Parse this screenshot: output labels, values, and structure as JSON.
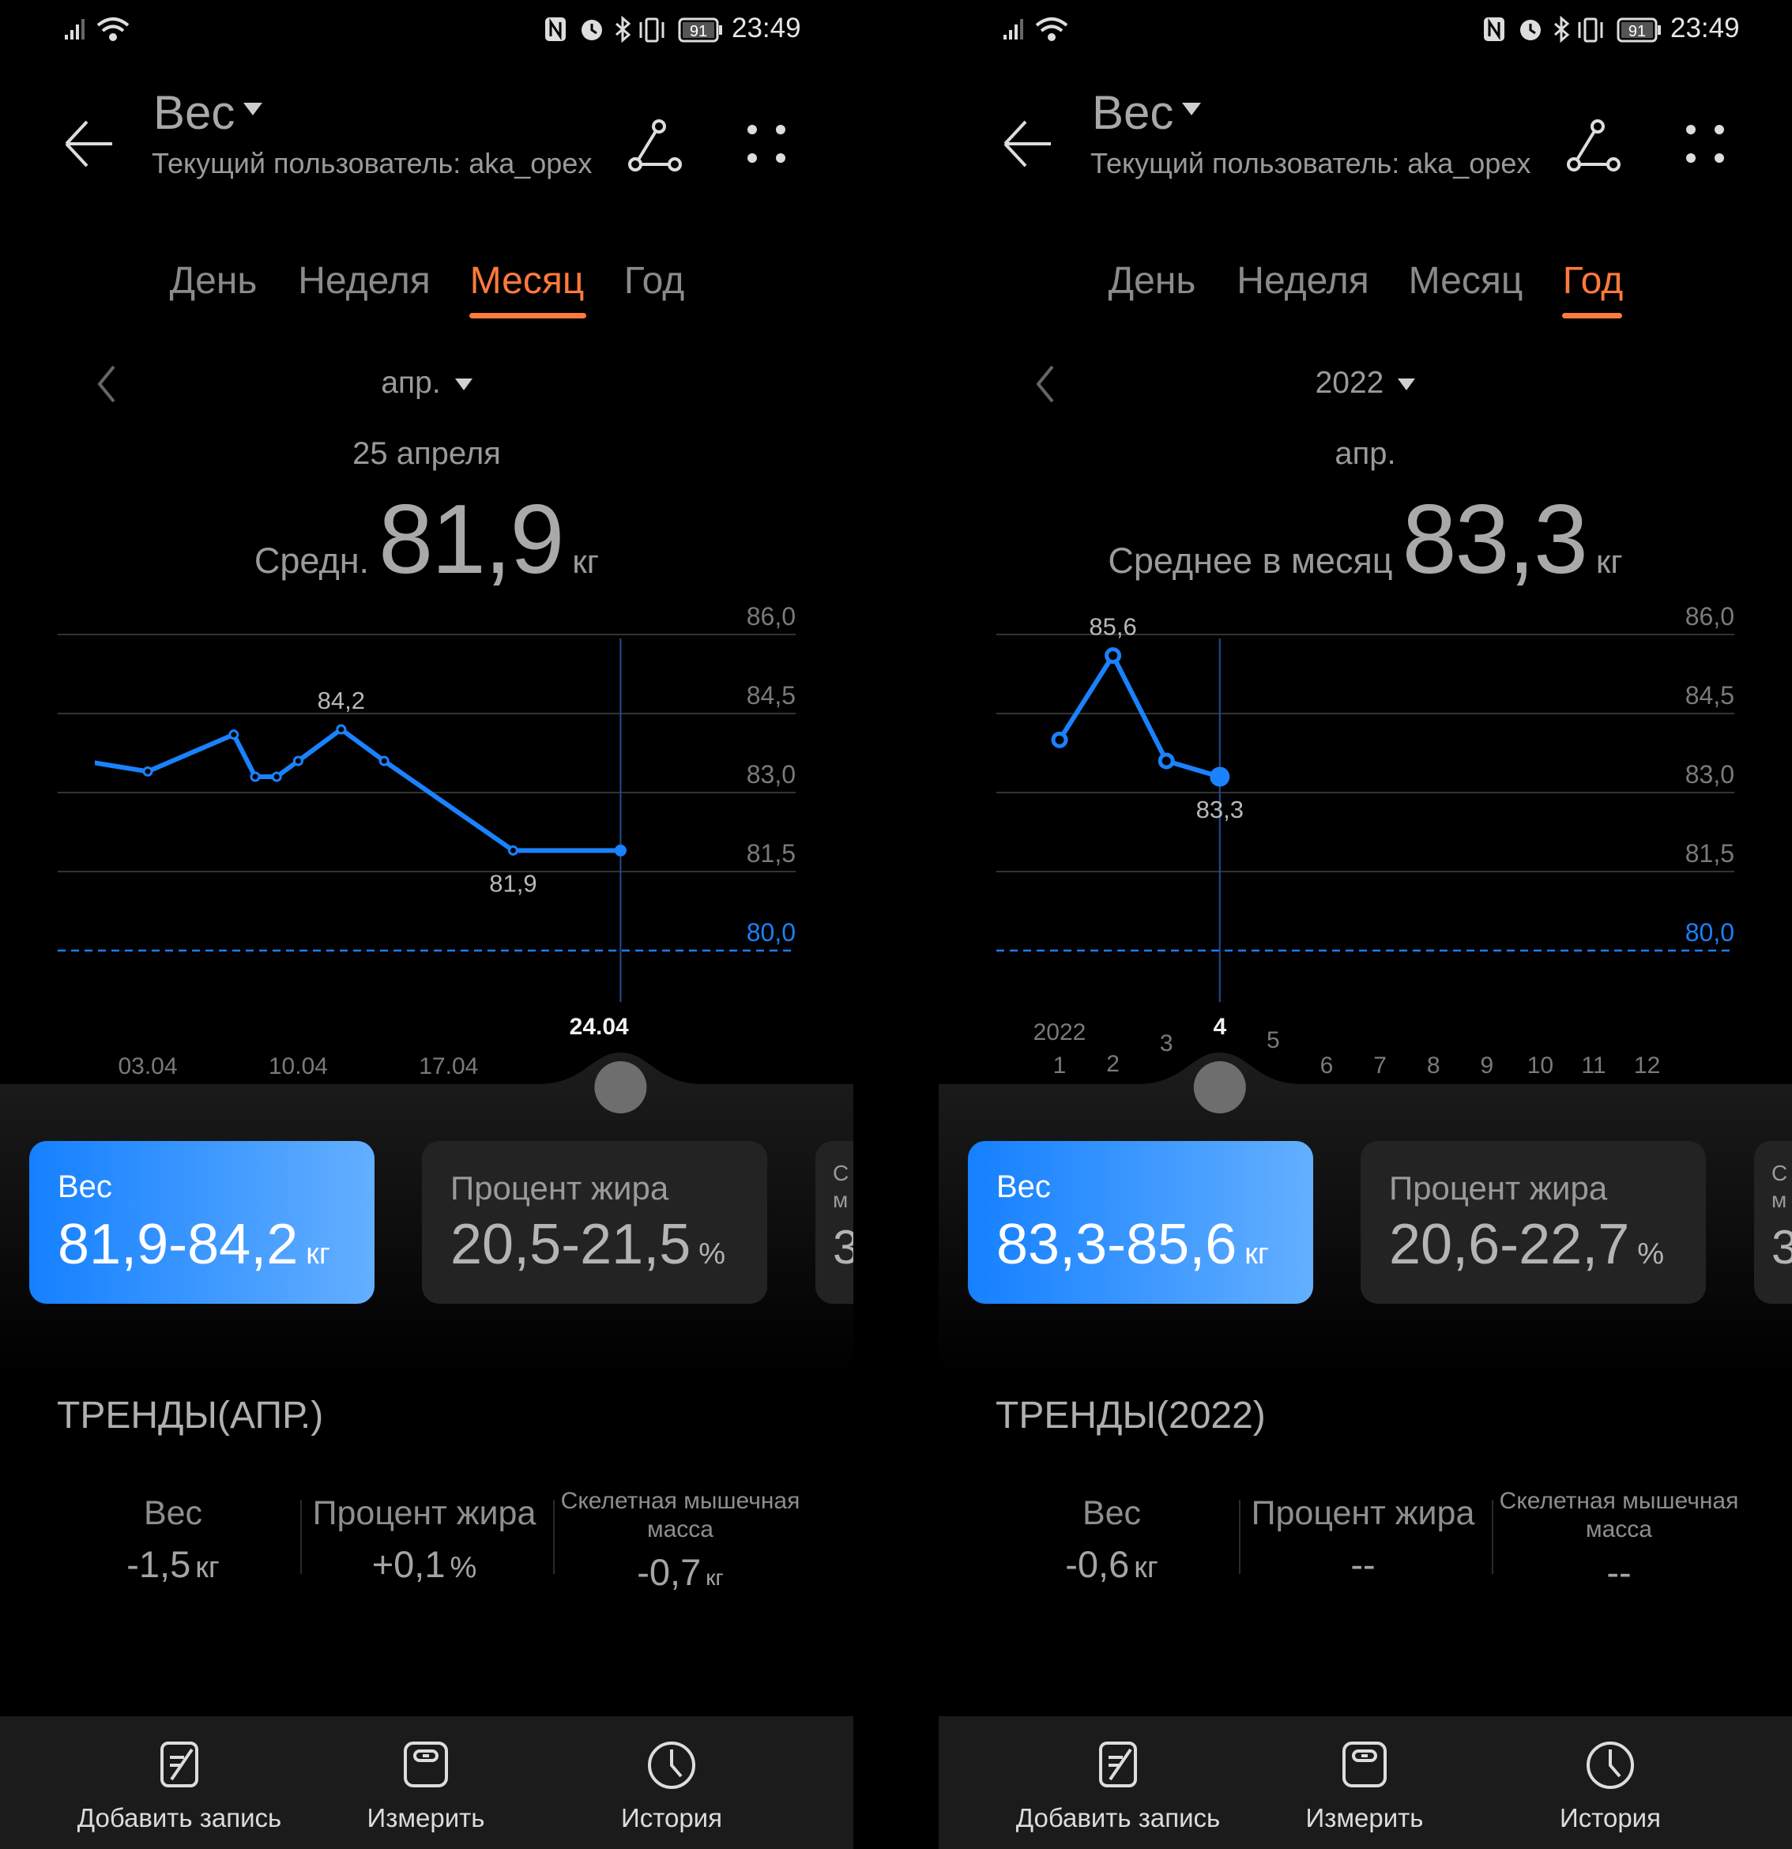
{
  "colors": {
    "accent_orange": "#ff7a3d",
    "series_blue": "#1a82ff",
    "target_blue": "#1a7fff",
    "card_gradient": [
      "#1580ff",
      "#63afff"
    ]
  },
  "phones": [
    {
      "status": {
        "time": "23:49",
        "battery": "91",
        "icons": [
          "signal-icon",
          "wifi-icon",
          "nfc-icon",
          "alarm-icon",
          "bluetooth-icon",
          "vibrate-icon",
          "battery-icon"
        ]
      },
      "header": {
        "title": "Вес",
        "subtitle": "Текущий пользователь: aka_opex",
        "icons": [
          "back-arrow-icon",
          "share-icon",
          "more-icon"
        ]
      },
      "tabs": [
        "День",
        "Неделя",
        "Месяц",
        "Год"
      ],
      "active_tab": 2,
      "period": {
        "label": "апр."
      },
      "selected": {
        "label": "25 апреля",
        "avg_label": "Средн.",
        "value": "81,9",
        "unit": "кг"
      },
      "cards": [
        {
          "label": "Вес",
          "value": "81,9-84,2",
          "unit": "кг",
          "active": true
        },
        {
          "label": "Процент жира",
          "value": "20,5-21,5",
          "unit": "%"
        },
        {
          "label": "С\nм",
          "value": "3"
        }
      ],
      "trends": {
        "title": "ТРЕНДЫ(АПР.)",
        "items": [
          {
            "label": "Вес",
            "value": "-1,5",
            "unit": "кг"
          },
          {
            "label": "Процент жира",
            "value": "+0,1",
            "unit": "%"
          },
          {
            "label": "Скелетная мышечная масса",
            "value": "-0,7",
            "unit": "кг"
          }
        ]
      },
      "bottom_nav": [
        {
          "label": "Добавить запись",
          "icon": "add-record-icon"
        },
        {
          "label": "Измерить",
          "icon": "scale-icon"
        },
        {
          "label": "История",
          "icon": "clock-icon"
        }
      ]
    },
    {
      "status": {
        "time": "23:49",
        "battery": "91",
        "icons": [
          "signal-icon",
          "wifi-icon",
          "nfc-icon",
          "alarm-icon",
          "bluetooth-icon",
          "vibrate-icon",
          "battery-icon"
        ]
      },
      "header": {
        "title": "Вес",
        "subtitle": "Текущий пользователь: aka_opex",
        "icons": [
          "back-arrow-icon",
          "share-icon",
          "more-icon"
        ]
      },
      "tabs": [
        "День",
        "Неделя",
        "Месяц",
        "Год"
      ],
      "active_tab": 3,
      "period": {
        "label": "2022"
      },
      "selected": {
        "label": "апр.",
        "avg_label": "Среднее в месяц",
        "value": "83,3",
        "unit": "кг"
      },
      "cards": [
        {
          "label": "Вес",
          "value": "83,3-85,6",
          "unit": "кг",
          "active": true
        },
        {
          "label": "Процент жира",
          "value": "20,6-22,7",
          "unit": "%"
        },
        {
          "label": "С\nм",
          "value": "3"
        }
      ],
      "trends": {
        "title": "ТРЕНДЫ(2022)",
        "items": [
          {
            "label": "Вес",
            "value": "-0,6",
            "unit": "кг"
          },
          {
            "label": "Процент жира",
            "value": "--",
            "unit": ""
          },
          {
            "label": "Скелетная мышечная масса",
            "value": "--",
            "unit": ""
          }
        ]
      },
      "bottom_nav": [
        {
          "label": "Добавить запись",
          "icon": "add-record-icon"
        },
        {
          "label": "Измерить",
          "icon": "scale-icon"
        },
        {
          "label": "История",
          "icon": "clock-icon"
        }
      ]
    }
  ],
  "chart_data": [
    {
      "type": "line",
      "x_unit": "date",
      "x_tick_labels": [
        "03.04",
        "10.04",
        "17.04",
        "24.04"
      ],
      "highlighted_tick": "24.04",
      "points": [
        {
          "x": "31.03",
          "y": 83.6
        },
        {
          "x": "03.04",
          "y": 83.4
        },
        {
          "x": "07.04",
          "y": 84.1
        },
        {
          "x": "08.04",
          "y": 83.3
        },
        {
          "x": "09.04",
          "y": 83.3
        },
        {
          "x": "10.04",
          "y": 83.6
        },
        {
          "x": "12.04",
          "y": 84.2
        },
        {
          "x": "14.04",
          "y": 83.6
        },
        {
          "x": "20.04",
          "y": 81.9
        },
        {
          "x": "25.04",
          "y": 81.9
        }
      ],
      "selected_x": "25.04",
      "point_labels": [
        {
          "x": "12.04",
          "text": "84,2",
          "pos": "above"
        },
        {
          "x": "20.04",
          "text": "81,9",
          "pos": "below"
        }
      ],
      "y_ticks": [
        86.0,
        84.5,
        83.0,
        81.5,
        80.0
      ],
      "y_tick_labels": [
        "86,0",
        "84,5",
        "83,0",
        "81,5",
        "80,0"
      ],
      "target_line": {
        "value": 80.0,
        "label": "80,0"
      },
      "ylim": [
        80.0,
        86.0
      ],
      "grid": true
    },
    {
      "type": "line",
      "x_unit": "month",
      "x_year_label": "2022",
      "x_tick_labels": [
        "1",
        "2",
        "3",
        "4",
        "5",
        "6",
        "7",
        "8",
        "9",
        "10",
        "11",
        "12"
      ],
      "highlighted_tick": "4",
      "points": [
        {
          "x": 1,
          "y": 84.0
        },
        {
          "x": 2,
          "y": 85.6
        },
        {
          "x": 3,
          "y": 83.6
        },
        {
          "x": 4,
          "y": 83.3
        }
      ],
      "selected_x": 4,
      "point_labels": [
        {
          "x": 2,
          "text": "85,6",
          "pos": "above"
        },
        {
          "x": 4,
          "text": "83,3",
          "pos": "below"
        }
      ],
      "y_ticks": [
        86.0,
        84.5,
        83.0,
        81.5,
        80.0
      ],
      "y_tick_labels": [
        "86,0",
        "84,5",
        "83,0",
        "81,5",
        "80,0"
      ],
      "target_line": {
        "value": 80.0,
        "label": "80,0"
      },
      "ylim": [
        80.0,
        86.0
      ],
      "grid": true
    }
  ]
}
